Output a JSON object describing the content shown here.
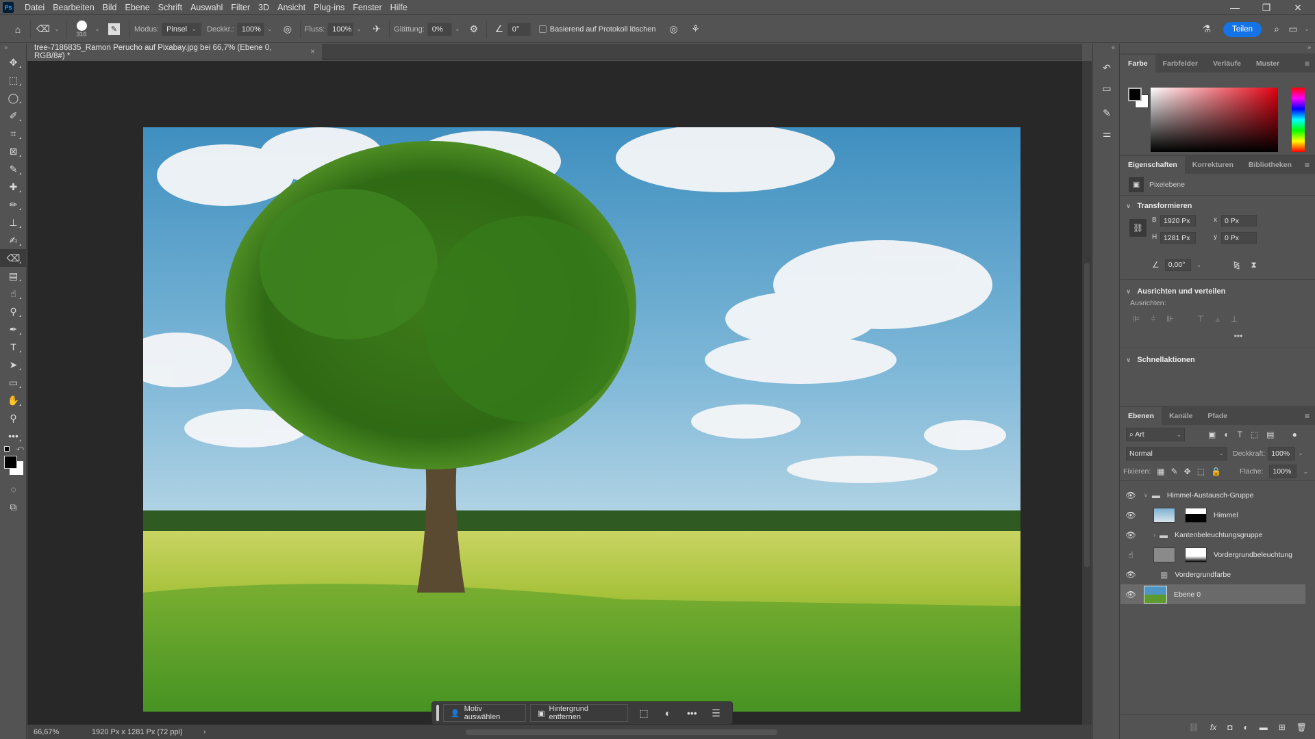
{
  "app": {
    "logo": "Ps"
  },
  "menu": [
    "Datei",
    "Bearbeiten",
    "Bild",
    "Ebene",
    "Schrift",
    "Auswahl",
    "Filter",
    "3D",
    "Ansicht",
    "Plug-ins",
    "Fenster",
    "Hilfe"
  ],
  "window_controls": {
    "minimize": "—",
    "restore": "❐",
    "close": "✕"
  },
  "options": {
    "brush_size": "316",
    "modus_label": "Modus:",
    "modus_value": "Pinsel",
    "deckkr_label": "Deckkr.:",
    "deckkr_value": "100%",
    "fluss_label": "Fluss:",
    "fluss_value": "100%",
    "glaettung_label": "Glättung:",
    "glaettung_value": "0%",
    "angle_value": "0°",
    "protocol_checkbox_label": "Basierend auf Protokoll löschen",
    "protocol_checked": false,
    "share_label": "Teilen"
  },
  "document": {
    "tab_title": "tree-7186835_Ramon Perucho auf Pixabay.jpg bei 66,7% (Ebene 0, RGB/8#) *",
    "close": "×"
  },
  "status": {
    "zoom": "66,67%",
    "doc_info": "1920 Px x 1281 Px (72 ppi)",
    "arrow": "›"
  },
  "context_bar": {
    "select_subject": "Motiv auswählen",
    "remove_background": "Hintergrund entfernen"
  },
  "color_panel": {
    "tabs": [
      "Farbe",
      "Farbfelder",
      "Verläufe",
      "Muster"
    ],
    "active_tab": 0,
    "foreground": "#000000",
    "background": "#ffffff",
    "hue": "#ff0000"
  },
  "properties_panel": {
    "tabs": [
      "Eigenschaften",
      "Korrekturen",
      "Bibliotheken"
    ],
    "active_tab": 0,
    "layer_type": "Pixelebene",
    "transform_title": "Transformieren",
    "w_label": "B",
    "w_value": "1920 Px",
    "h_label": "H",
    "h_value": "1281 Px",
    "x_label": "x",
    "x_value": "0 Px",
    "y_label": "y",
    "y_value": "0 Px",
    "angle_value": "0,00°",
    "align_title": "Ausrichten und verteilen",
    "align_label": "Ausrichten:",
    "more": "•••",
    "quick_actions_title": "Schnellaktionen"
  },
  "layers_panel": {
    "tabs": [
      "Ebenen",
      "Kanäle",
      "Pfade"
    ],
    "active_tab": 0,
    "filter_label": "Art",
    "blend_mode": "Normal",
    "opacity_label": "Deckkraft:",
    "opacity_value": "100%",
    "lock_label": "Fixieren:",
    "fill_label": "Fläche:",
    "fill_value": "100%",
    "layers": [
      {
        "name": "Himmel-Austausch-Gruppe",
        "type": "group",
        "expanded": true,
        "visible": true
      },
      {
        "name": "Himmel",
        "type": "pixel-mask",
        "visible": true
      },
      {
        "name": "Kantenbeleuchtungsgruppe",
        "type": "group",
        "expanded": false,
        "visible": true
      },
      {
        "name": "Vordergrundbeleuchtung",
        "type": "pixel-mask",
        "visible": true
      },
      {
        "name": "Vordergrundfarbe",
        "type": "adjustment",
        "visible": true
      },
      {
        "name": "Ebene 0",
        "type": "pixel",
        "visible": true,
        "selected": true
      }
    ]
  }
}
